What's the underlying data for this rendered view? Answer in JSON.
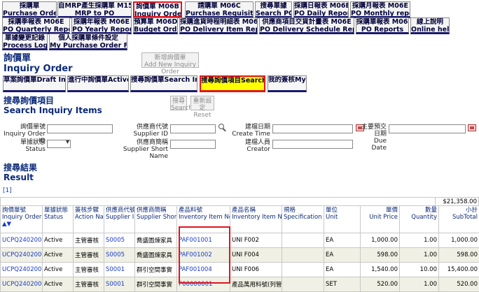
{
  "top_tabs_row1": [
    {
      "zh": "採購單",
      "en": "Purchase Order"
    },
    {
      "zh": "自MRP產生採購單 M15B",
      "en": "MRP to PO"
    },
    {
      "zh": "詢價單 M06B",
      "en": "Inquiry Order"
    },
    {
      "zh": "請購單 M06C",
      "en": "Purchase Requisition"
    },
    {
      "zh": "搜尋單據",
      "en": "Search PO"
    },
    {
      "zh": "採購日報表 M06E",
      "en": "PO Daily Report"
    },
    {
      "zh": "採購月報表 M06E",
      "en": "PO Monthly report"
    }
  ],
  "top_tabs_row2": [
    {
      "zh": "採購季報表 M06E",
      "en": "PO Quarterly Report"
    },
    {
      "zh": "採購年報表 M06E",
      "en": "PO Yearly Report"
    },
    {
      "zh": "預算單 M06D",
      "en": "Budget Order"
    },
    {
      "zh": "採購進貨時程明細表 M06E",
      "en": "PO Delivery Item Report"
    },
    {
      "zh": "供應商項目交貨計畫表 M06E",
      "en": "PO Delivery Schedule Report"
    },
    {
      "zh": "採購單報表 M06E",
      "en": "PO Reports"
    },
    {
      "zh": "線上說明",
      "en": "Online help"
    }
  ],
  "top_tabs_row3": [
    {
      "zh": "單據變更記錄",
      "en": "Process Log"
    },
    {
      "zh": "個人採購單條件設定",
      "en": "My Purchase Order Filter"
    }
  ],
  "page_title": {
    "zh": "詢價單",
    "en": "Inquiry Order"
  },
  "add_button": {
    "zh": "新增詢價單",
    "en": "Add New Inquiry Order"
  },
  "sub_tabs": [
    {
      "zh": "草案詢價單",
      "en": "Draft Inquiry Order"
    },
    {
      "zh": "進行中詢價單",
      "en": "Active Inquiry Order"
    },
    {
      "zh": "搜尋詢價單",
      "en": "Search Inquiry Orders"
    },
    {
      "zh": "搜尋詢價項目",
      "en": "Search Inquiry Items"
    },
    {
      "zh": "我的簽核",
      "en": "My Approval"
    }
  ],
  "search_title": {
    "zh": "搜尋詢價項目",
    "en": "Search Inquiry Items"
  },
  "search_btn": {
    "zh": "搜尋",
    "en": "Search"
  },
  "reset_btn": {
    "zh": "重新設定",
    "en": "Reset"
  },
  "fields": {
    "inquiry_id": {
      "zh": "詢價單號",
      "en": "Inquiry Order ID"
    },
    "status": {
      "zh": "單據狀態",
      "en": "Status"
    },
    "supplier_id": {
      "zh": "供應商代號",
      "en": "Supplier ID"
    },
    "supplier_name": {
      "zh": "供應商簡稱",
      "en": "Supplier Short Name"
    },
    "create_time": {
      "zh": "建檔日期",
      "en": "Create Time"
    },
    "creator": {
      "zh": "建檔人員",
      "en": "Creator"
    },
    "due_date": {
      "zh": "主要預交日期",
      "en": "Due Date"
    }
  },
  "result_title": {
    "zh": "搜尋結果",
    "en": "Result"
  },
  "pager": "[1]",
  "total": "$21,358.00",
  "columns": [
    {
      "zh": "詢價單號",
      "en": "Inquiry Order ID",
      "sort": "▲▼"
    },
    {
      "zh": "單據狀態",
      "en": "Status"
    },
    {
      "zh": "簽核步驟",
      "en": "Action Name"
    },
    {
      "zh": "供應商代號",
      "en": "Supplier ID"
    },
    {
      "zh": "供應商簡稱",
      "en": "Supplier Short Name"
    },
    {
      "zh": "產品料號",
      "en": "Inventory Item No"
    },
    {
      "zh": "產品名稱",
      "en": "Inventory Item Name"
    },
    {
      "zh": "規格",
      "en": "Specification"
    },
    {
      "zh": "單位",
      "en": "Unit"
    },
    {
      "zh": "單價",
      "en": "Unit Price"
    },
    {
      "zh": "數量",
      "en": "Quantity"
    },
    {
      "zh": "小計",
      "en": "SubTotal"
    }
  ],
  "rows": [
    [
      "UCPQ24020001",
      "Active",
      "主管審核",
      "S0005",
      "喬盛圖煉家具",
      "PAF001001",
      "UNI F002",
      "",
      "EA",
      "1,000.00",
      "1.00",
      "1,000.00"
    ],
    [
      "UCPQ24020001",
      "Active",
      "主管審核",
      "S0005",
      "喬盛圖煉家具",
      "PAF001002",
      "UNI F004",
      "",
      "EA",
      "598.00",
      "1.00",
      "598.00"
    ],
    [
      "UCPQ24020002",
      "Active",
      "主管審核",
      "S0001",
      "群引空間事實",
      "PAF001004",
      "UNI F006",
      "",
      "EA",
      "1,540.00",
      "10.00",
      "15,400.00"
    ],
    [
      "UCPQ24020002",
      "Active",
      "主管審核",
      "S0001",
      "群引空間事實",
      "P00000001",
      "產品萬用料號(列管)",
      "",
      "SET",
      "520.00",
      "1.00",
      "520.00"
    ]
  ]
}
